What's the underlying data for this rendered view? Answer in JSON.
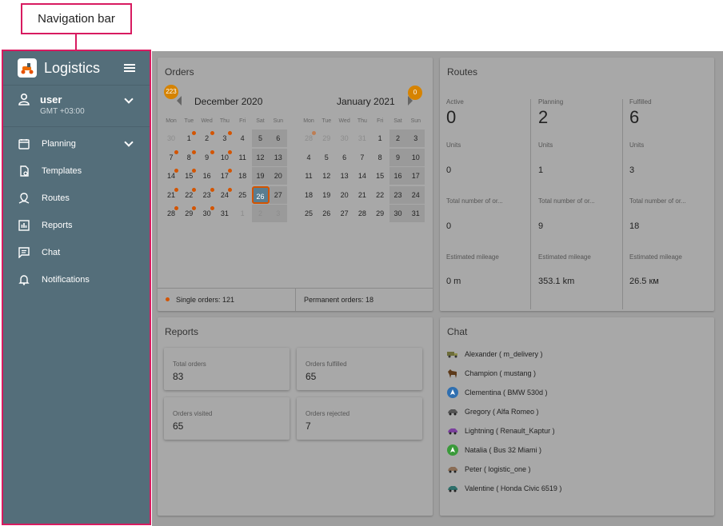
{
  "annotation": {
    "label": "Navigation bar"
  },
  "app": {
    "title": "Logistics"
  },
  "user": {
    "name": "user",
    "timezone": "GMT +03:00"
  },
  "nav": [
    {
      "label": "Planning",
      "icon": "calendar-icon"
    },
    {
      "label": "Templates",
      "icon": "template-icon"
    },
    {
      "label": "Routes",
      "icon": "routes-icon"
    },
    {
      "label": "Reports",
      "icon": "reports-icon"
    },
    {
      "label": "Chat",
      "icon": "chat-icon"
    },
    {
      "label": "Notifications",
      "icon": "bell-icon"
    }
  ],
  "orders": {
    "title": "Orders",
    "prev_badge": "223",
    "next_badge": "0",
    "weekdays": [
      "Mon",
      "Tue",
      "Wed",
      "Thu",
      "Fri",
      "Sat",
      "Sun"
    ],
    "months": [
      {
        "title": "December 2020",
        "weeks": [
          [
            {
              "d": "30",
              "o": 1
            },
            {
              "d": "1",
              "dot": 1
            },
            {
              "d": "2",
              "dot": 1
            },
            {
              "d": "3",
              "dot": 1
            },
            {
              "d": "4"
            },
            {
              "d": "5"
            },
            {
              "d": "6"
            }
          ],
          [
            {
              "d": "7",
              "dot": 1
            },
            {
              "d": "8",
              "dot": 1
            },
            {
              "d": "9",
              "dot": 1
            },
            {
              "d": "10",
              "dot": 1
            },
            {
              "d": "11"
            },
            {
              "d": "12"
            },
            {
              "d": "13"
            }
          ],
          [
            {
              "d": "14",
              "dot": 1
            },
            {
              "d": "15",
              "dot": 1
            },
            {
              "d": "16"
            },
            {
              "d": "17",
              "dot": 1
            },
            {
              "d": "18"
            },
            {
              "d": "19"
            },
            {
              "d": "20"
            }
          ],
          [
            {
              "d": "21",
              "dot": 1
            },
            {
              "d": "22",
              "dot": 1
            },
            {
              "d": "23",
              "dot": 1
            },
            {
              "d": "24",
              "dot": 1
            },
            {
              "d": "25"
            },
            {
              "d": "26",
              "sel": 1
            },
            {
              "d": "27"
            }
          ],
          [
            {
              "d": "28",
              "dot": 1
            },
            {
              "d": "29",
              "dot": 1
            },
            {
              "d": "30",
              "dot": 1
            },
            {
              "d": "31"
            },
            {
              "d": "1",
              "o": 1
            },
            {
              "d": "2",
              "o": 1
            },
            {
              "d": "3",
              "o": 1
            }
          ]
        ]
      },
      {
        "title": "January 2021",
        "weeks": [
          [
            {
              "d": "28",
              "o": 1,
              "dot": 1
            },
            {
              "d": "29",
              "o": 1
            },
            {
              "d": "30",
              "o": 1
            },
            {
              "d": "31",
              "o": 1
            },
            {
              "d": "1"
            },
            {
              "d": "2"
            },
            {
              "d": "3"
            }
          ],
          [
            {
              "d": "4"
            },
            {
              "d": "5"
            },
            {
              "d": "6"
            },
            {
              "d": "7"
            },
            {
              "d": "8"
            },
            {
              "d": "9"
            },
            {
              "d": "10"
            }
          ],
          [
            {
              "d": "11"
            },
            {
              "d": "12"
            },
            {
              "d": "13"
            },
            {
              "d": "14"
            },
            {
              "d": "15"
            },
            {
              "d": "16"
            },
            {
              "d": "17"
            }
          ],
          [
            {
              "d": "18"
            },
            {
              "d": "19"
            },
            {
              "d": "20"
            },
            {
              "d": "21"
            },
            {
              "d": "22"
            },
            {
              "d": "23"
            },
            {
              "d": "24"
            }
          ],
          [
            {
              "d": "25"
            },
            {
              "d": "26"
            },
            {
              "d": "27"
            },
            {
              "d": "28"
            },
            {
              "d": "29"
            },
            {
              "d": "30"
            },
            {
              "d": "31"
            }
          ]
        ]
      }
    ],
    "single_orders": "Single orders: 121",
    "permanent_orders": "Permanent orders: 18"
  },
  "routes": {
    "title": "Routes",
    "columns": [
      {
        "status": "Active",
        "count": "0",
        "units_label": "Units",
        "units": "0",
        "orders_label": "Total number of or...",
        "orders": "0",
        "mileage_label": "Estimated mileage",
        "mileage": "0 m"
      },
      {
        "status": "Planning",
        "count": "2",
        "units_label": "Units",
        "units": "1",
        "orders_label": "Total number of or...",
        "orders": "9",
        "mileage_label": "Estimated mileage",
        "mileage": "353.1 km"
      },
      {
        "status": "Fulfilled",
        "count": "6",
        "units_label": "Units",
        "units": "3",
        "orders_label": "Total number of or...",
        "orders": "18",
        "mileage_label": "Estimated mileage",
        "mileage": "26.5 км"
      }
    ]
  },
  "reports": {
    "title": "Reports",
    "items": [
      {
        "label": "Total orders",
        "value": "83"
      },
      {
        "label": "Orders fulfilled",
        "value": "65"
      },
      {
        "label": "Orders visited",
        "value": "65"
      },
      {
        "label": "Orders rejected",
        "value": "7"
      }
    ]
  },
  "chat": {
    "title": "Chat",
    "items": [
      {
        "label": "Alexander ( m_delivery )",
        "icon": "truck-icon"
      },
      {
        "label": "Champion ( mustang )",
        "icon": "horse-icon"
      },
      {
        "label": "Clementina ( BMW 530d )",
        "icon": "navigation-arrow-icon"
      },
      {
        "label": "Gregory ( Alfa Romeo )",
        "icon": "car-icon"
      },
      {
        "label": "Lightning ( Renault_Kaptur )",
        "icon": "car-icon"
      },
      {
        "label": "Natalia ( Bus 32 Miami )",
        "icon": "navigation-arrow-icon"
      },
      {
        "label": "Peter ( logistic_one )",
        "icon": "car-icon"
      },
      {
        "label": "Valentine ( Honda Civic 6519 )",
        "icon": "car-icon"
      }
    ]
  }
}
